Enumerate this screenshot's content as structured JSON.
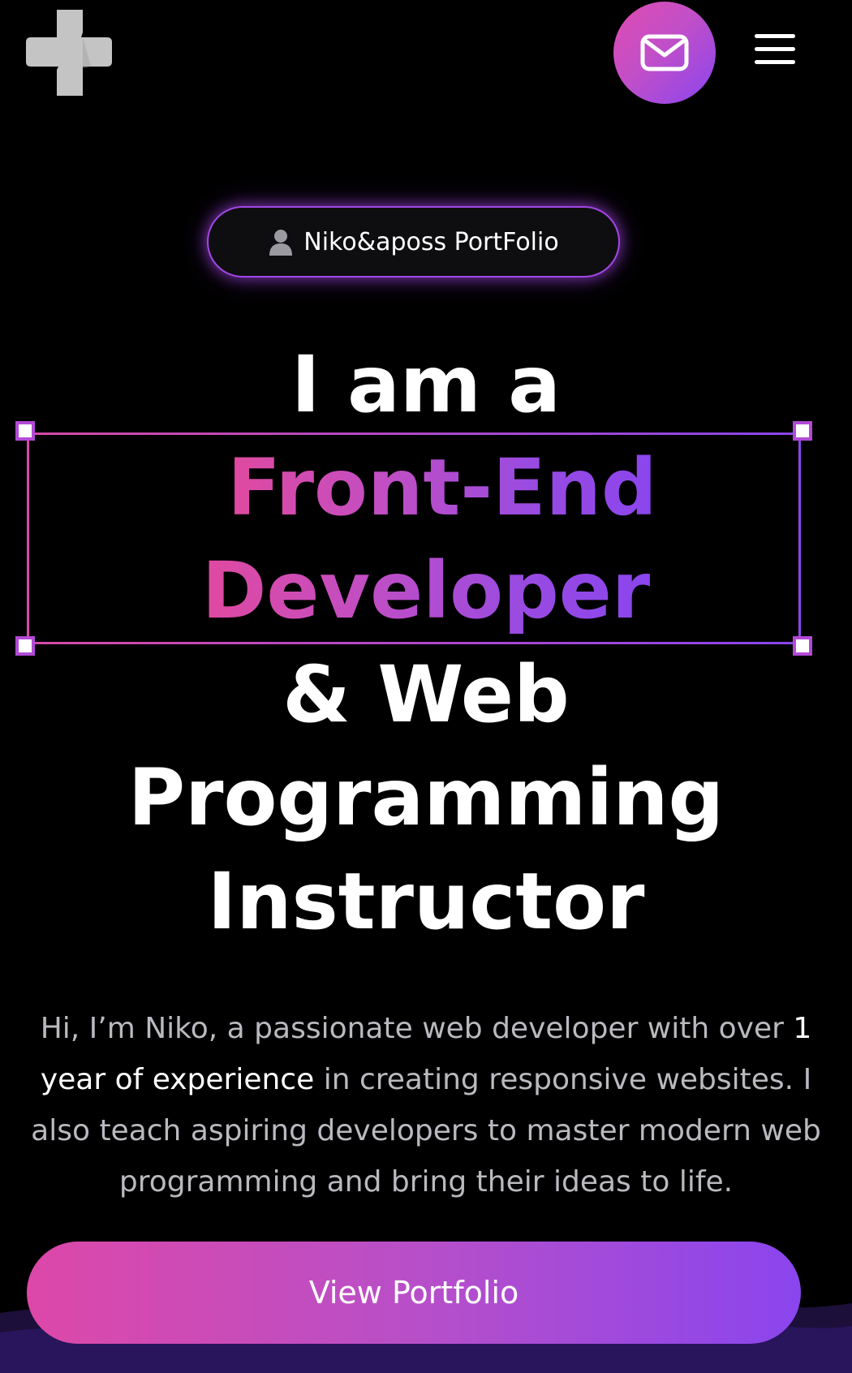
{
  "header": {
    "logo_icon": "plus-shape-logo",
    "mail_icon": "envelope-icon",
    "menu_icon": "hamburger-menu-icon"
  },
  "badge": {
    "icon": "user-silhouette-icon",
    "label": "Niko&aposs PortFolio"
  },
  "hero": {
    "line1": "I am a",
    "highlight_line1": "Front-End",
    "highlight_line2": "Developer",
    "line3": "& Web",
    "line4": "Programming",
    "line5": "Instructor"
  },
  "description": {
    "part1": "Hi, I’m Niko, a passionate web developer with over ",
    "highlight": "1 year of experience",
    "part2": " in creating responsive websites. I also teach aspiring developers to master modern web programming and bring their ideas to life."
  },
  "cta": {
    "label": "View Portfolio"
  },
  "colors": {
    "background": "#000000",
    "gradient_start": "#e0499f",
    "gradient_end": "#8a45ee",
    "text_muted": "#b9b9bf"
  }
}
